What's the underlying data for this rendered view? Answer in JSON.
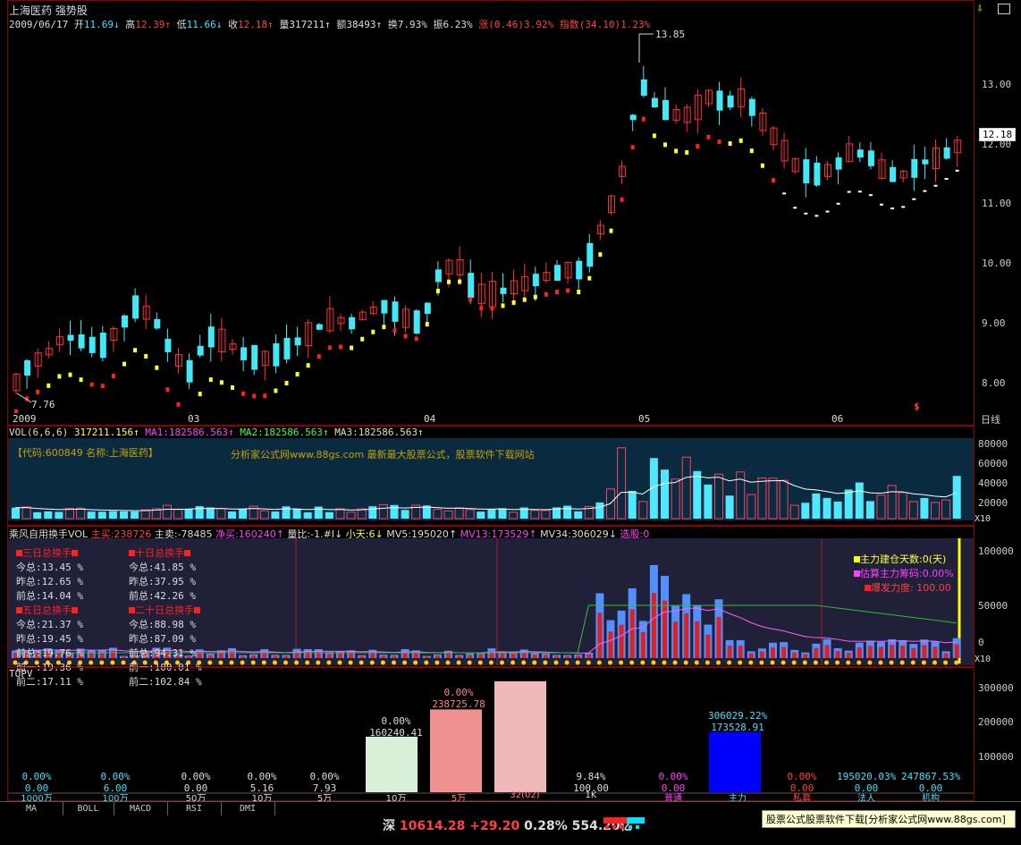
{
  "main": {
    "title": "上海医药 强势股",
    "date": "2009/06/17",
    "open_label": "开",
    "open": "11.69",
    "high_label": "高",
    "high": "12.39",
    "low_label": "低",
    "low": "11.66",
    "close_label": "收",
    "close": "12.18",
    "vol_label": "量",
    "vol": "317211",
    "amount_label": "额",
    "amount": "38493",
    "turnover_label": "换",
    "turnover": "7.93%",
    "amplitude_label": "振",
    "amplitude": "6.23%",
    "change_label": "涨",
    "change": "(0.46)3.92%",
    "index_label": "指数",
    "index": "(34.10)1.23%",
    "price_ticks": [
      "13.00",
      "12.00",
      "11.00",
      "10.00",
      "9.00",
      "8.00"
    ],
    "current_price": "12.18",
    "max_label": "13.85",
    "min_label": "7.76",
    "x_labels": [
      "2009",
      "03",
      "04",
      "05",
      "06"
    ],
    "period": "日线",
    "s_marker": "$"
  },
  "vol": {
    "header": "VOL(6,6,6)",
    "value": "317211.156",
    "ma1": "MA1:182586.563",
    "ma2": "MA2:182586.563",
    "ma3": "MA3:182586.563",
    "code_text": "【代码:600849 名称:上海医药】",
    "site_text": "分析家公式网www.88gs.com 最新最大股票公式，股票软件下载网站",
    "ticks": [
      "80000",
      "60000",
      "40000",
      "20000"
    ],
    "unit": "X10"
  },
  "turn": {
    "header": "乘风自用换手VOL",
    "buy": "主买:238726",
    "sell": "主卖:-78485",
    "net": "净买:160240",
    "ratio": "量比:-1.#I",
    "days": "小天:6",
    "mv5": "MV5:195020",
    "mv13": "MV13:173529",
    "mv34": "MV34:306029",
    "pick": "选股:0",
    "left_block_title": "三日总换手",
    "left_block": [
      "今总:13.45 %",
      "昨总:12.65 %",
      "前总:14.04 %"
    ],
    "left_block2_title": "五日总换手",
    "left_block2": [
      "今总:21.37 %",
      "昨总:19.45 %",
      "前总:19.76 %",
      "前一:19.36 %",
      "前二:17.11 %"
    ],
    "mid_block_title": "十日总换手",
    "mid_block": [
      "今总:41.85 %",
      "昨总:37.95 %",
      "前总:42.26 %"
    ],
    "mid_block2_title": "二十日总换手",
    "mid_block2": [
      "今总:88.98 %",
      "昨总:87.09 %",
      "前总:94.31 %",
      "前一:100.01 %",
      "前二:102.84 %"
    ],
    "legend": [
      "主力建仓天数:0(天)",
      "估算主力筹码:0.00%",
      "爆发力度: 100.00"
    ],
    "ticks": [
      "100000",
      "50000",
      "0"
    ],
    "unit": "X10"
  },
  "topv": {
    "header": "TOPV",
    "ticks": [
      "300000",
      "200000",
      "100000"
    ],
    "colors": {
      "buy10w": "#d8f0d8",
      "buy5w": "#f09090",
      "buy32": "#f0b8b8",
      "blue": "#0000ff"
    },
    "cols": [
      {
        "pct": "0.00%",
        "val": "0.00",
        "label": "1000万",
        "color": "#40e0ff"
      },
      {
        "pct": "0.00%",
        "val": "6.00",
        "label": "100万",
        "color": "#40e0ff"
      },
      {
        "pct": "0.00%",
        "val": "0.00",
        "label": "50万",
        "color": "#ddd"
      },
      {
        "pct": "0.00%",
        "val": "5.16",
        "label": "10万",
        "color": "#ddd"
      },
      {
        "pct": "0.00%",
        "val": "7.93",
        "label": "5万",
        "color": "#ddd"
      },
      {
        "pct": "0.00%",
        "val": "160240.41",
        "label": "10万",
        "color": "#ddd"
      },
      {
        "pct": "0.00%",
        "val": "238725.78",
        "label": "5万",
        "color": "#ff8080"
      },
      {
        "pct": "",
        "val": "",
        "label": "32(02)",
        "color": "#ff8080"
      },
      {
        "pct": "9.84%",
        "val": "100.00",
        "label": "1K",
        "color": "#ddd"
      },
      {
        "pct": "0.00%",
        "val": "0.00",
        "label": "普通",
        "color": "#ff40ff"
      },
      {
        "pct": "306029.22%",
        "val": "173528.91",
        "label": "主力",
        "color": "#40e0ff"
      },
      {
        "pct": "0.00%",
        "val": "0.00",
        "label": "私募",
        "color": "#ff4040"
      },
      {
        "pct": "195020.03%",
        "val": "0.00",
        "label": "法人",
        "color": "#40e0ff"
      },
      {
        "pct": "247867.53%",
        "val": "0.00",
        "label": "机构",
        "color": "#40e0ff"
      }
    ]
  },
  "tabs": [
    "MA",
    "BOLL",
    "MACD",
    "RSI",
    "DMI"
  ],
  "status": {
    "market": "深",
    "index": "10614.28",
    "change": "+29.20",
    "pct": "0.28%",
    "amount": "554.20亿"
  },
  "ad_text": "股票公式股票软件下载[分析家公式网www.88gs.com]",
  "chart_data": {
    "type": "bar",
    "title": "TOPV",
    "categories": [
      "10万",
      "5万",
      "32(02)",
      "主力"
    ],
    "values": [
      160240.41,
      238725.78,
      320000,
      173528.91
    ],
    "ylim": [
      0,
      330000
    ]
  }
}
